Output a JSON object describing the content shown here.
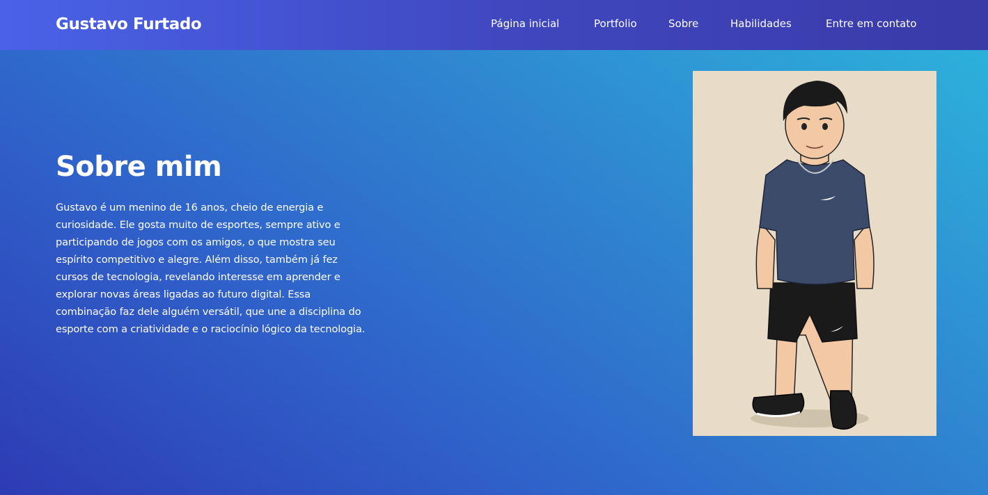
{
  "brand": "Gustavo Furtado",
  "nav": {
    "items": [
      "Página inicial",
      "Portfolio",
      "Sobre",
      "Habilidades",
      "Entre em contato"
    ]
  },
  "about": {
    "title": "Sobre mim",
    "text": "Gustavo é um menino de 16 anos, cheio de energia e curiosidade. Ele gosta muito de esportes, sempre ativo e participando de jogos com os amigos, o que mostra seu espírito competitivo e alegre. Além disso, também já fez cursos de tecnologia, revelando interesse em aprender e explorar novas áreas ligadas ao futuro digital. Essa combinação faz dele alguém versátil, que une a disciplina do esporte com a criatividade e o raciocínio lógico da tecnologia."
  },
  "portrait": {
    "description_icon": "cartoon-boy-portrait"
  },
  "colors": {
    "navbar": "#4254d8",
    "background_start": "#2cb6dc",
    "background_end": "#2e3bb4",
    "portrait_bg": "#e8dcc8",
    "text": "#ffffff"
  }
}
